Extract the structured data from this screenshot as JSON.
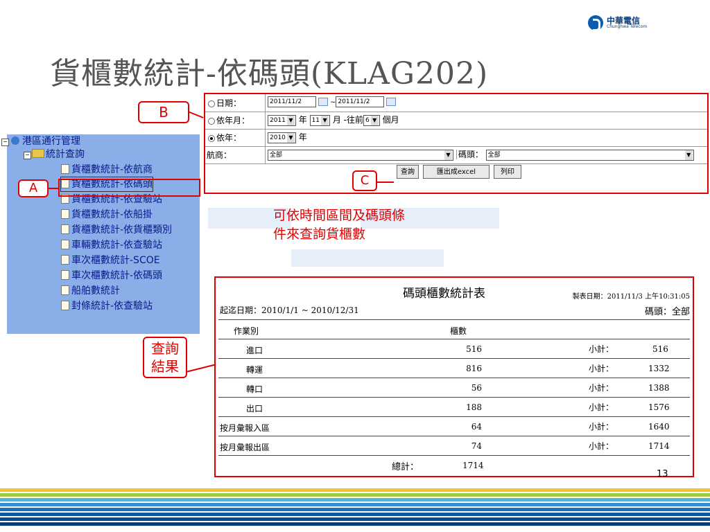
{
  "logo": {
    "cn": "中華電信",
    "en": "Chunghwa Telecom"
  },
  "title": "貨櫃數統計-依碼頭(KLAG202)",
  "tree": {
    "root": "港區通行管理",
    "folder": "統計查詢",
    "items": [
      "貨櫃數統計-依航商",
      "貨櫃數統計-依碼頭",
      "貨櫃數統計-依查驗站",
      "貨櫃數統計-依船掛",
      "貨櫃數統計-依貨櫃類別",
      "車輛數統計-依查驗站",
      "車次櫃數統計-SCOE",
      "車次櫃數統計-依碼頭",
      "船舶數統計",
      "封條統計-依查驗站"
    ]
  },
  "form": {
    "date_label": "日期：",
    "date_from": "2011/11/2",
    "date_sep": "~",
    "date_to": "2011/11/2",
    "ym_label": "依年月：",
    "ym_year": "2011",
    "ym_year_unit": "年",
    "ym_month": "11",
    "ym_month_unit": "月 -往前",
    "ym_back": "6",
    "ym_back_unit": "個月",
    "year_label": "依年：",
    "year_value": "2010",
    "year_unit": "年",
    "carrier_label": "航商：",
    "carrier_value": "全部",
    "wharf_label": "碼頭：",
    "wharf_value": "全部",
    "query_button": "查詢",
    "excel_button": "匯出成excel",
    "print_button": "列印"
  },
  "callouts": {
    "a": "A",
    "b": "B",
    "c": "C",
    "result_line1": "查詢",
    "result_line2": "結果"
  },
  "note_line1": "可依時間區間及碼頭條",
  "note_line2": "件來查詢貨櫃數",
  "report": {
    "title": "碼頭櫃數統計表",
    "made_date": "製表日期：2011/11/3 上午10:31:05",
    "range": "起迄日期：2010/1/1 ~ 2010/12/31",
    "wharf": "碼頭：全部",
    "col_type": "作業別",
    "col_count": "櫃數",
    "rows": [
      {
        "type": "進口",
        "count": "516",
        "sub_label": "小計：",
        "sub": "516"
      },
      {
        "type": "轉運",
        "count": "816",
        "sub_label": "小計：",
        "sub": "1332"
      },
      {
        "type": "轉口",
        "count": "56",
        "sub_label": "小計：",
        "sub": "1388"
      },
      {
        "type": "出口",
        "count": "188",
        "sub_label": "小計：",
        "sub": "1576"
      },
      {
        "type": "按月彙報入區",
        "count": "64",
        "sub_label": "小計：",
        "sub": "1640"
      },
      {
        "type": "按月彙報出區",
        "count": "74",
        "sub_label": "小計：",
        "sub": "1714"
      }
    ],
    "total_label": "總計：",
    "total": "1714"
  },
  "page_number": "13"
}
